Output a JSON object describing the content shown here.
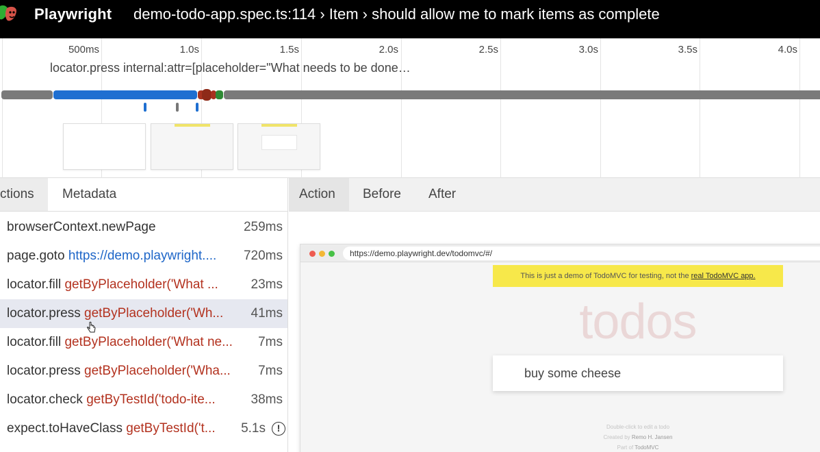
{
  "app": {
    "brand": "Playwright",
    "title": "demo-todo-app.spec.ts:114 › Item › should allow me to mark items as complete"
  },
  "timeline": {
    "ticks": [
      "500ms",
      "1.0s",
      "1.5s",
      "2.0s",
      "2.5s",
      "3.0s",
      "3.5s",
      "4.0s"
    ],
    "hover_text": "locator.press internal:attr=[placeholder=\"What needs to be done…",
    "colors": {
      "gray": "#7a7a7a",
      "blue": "#1f6fd1",
      "red": "#a8321f",
      "green": "#2e8a34"
    }
  },
  "left_tabs": {
    "actions": "ctions",
    "metadata": "Metadata"
  },
  "actions": [
    {
      "name": "browserContext.newPage",
      "target": "",
      "duration": "259ms"
    },
    {
      "name": "page.goto",
      "target": "https://demo.playwright....",
      "duration": "720ms"
    },
    {
      "name": "locator.fill",
      "target": "getByPlaceholder('What ...",
      "duration": "23ms"
    },
    {
      "name": "locator.press",
      "target": "getByPlaceholder('Wh...",
      "duration": "41ms"
    },
    {
      "name": "locator.fill",
      "target": "getByPlaceholder('What ne...",
      "duration": "7ms"
    },
    {
      "name": "locator.press",
      "target": "getByPlaceholder('Wha...",
      "duration": "7ms"
    },
    {
      "name": "locator.check",
      "target": "getByTestId('todo-ite...",
      "duration": "38ms"
    },
    {
      "name": "expect.toHaveClass",
      "target": "getByTestId('t...",
      "duration": "5.1s"
    }
  ],
  "right_tabs": {
    "action": "Action",
    "before": "Before",
    "after": "After"
  },
  "preview": {
    "url": "https://demo.playwright.dev/todomvc/#/",
    "banner_text": "This is just a demo of TodoMVC for testing, not the ",
    "banner_link": "real TodoMVC app.",
    "heading": "todos",
    "input_value": "buy some cheese",
    "footer_hint": "Double-click to edit a todo",
    "footer_created_prefix": "Created by ",
    "footer_created_name": "Remo H. Jansen",
    "footer_part_prefix": "Part of ",
    "footer_part_name": "TodoMVC"
  }
}
